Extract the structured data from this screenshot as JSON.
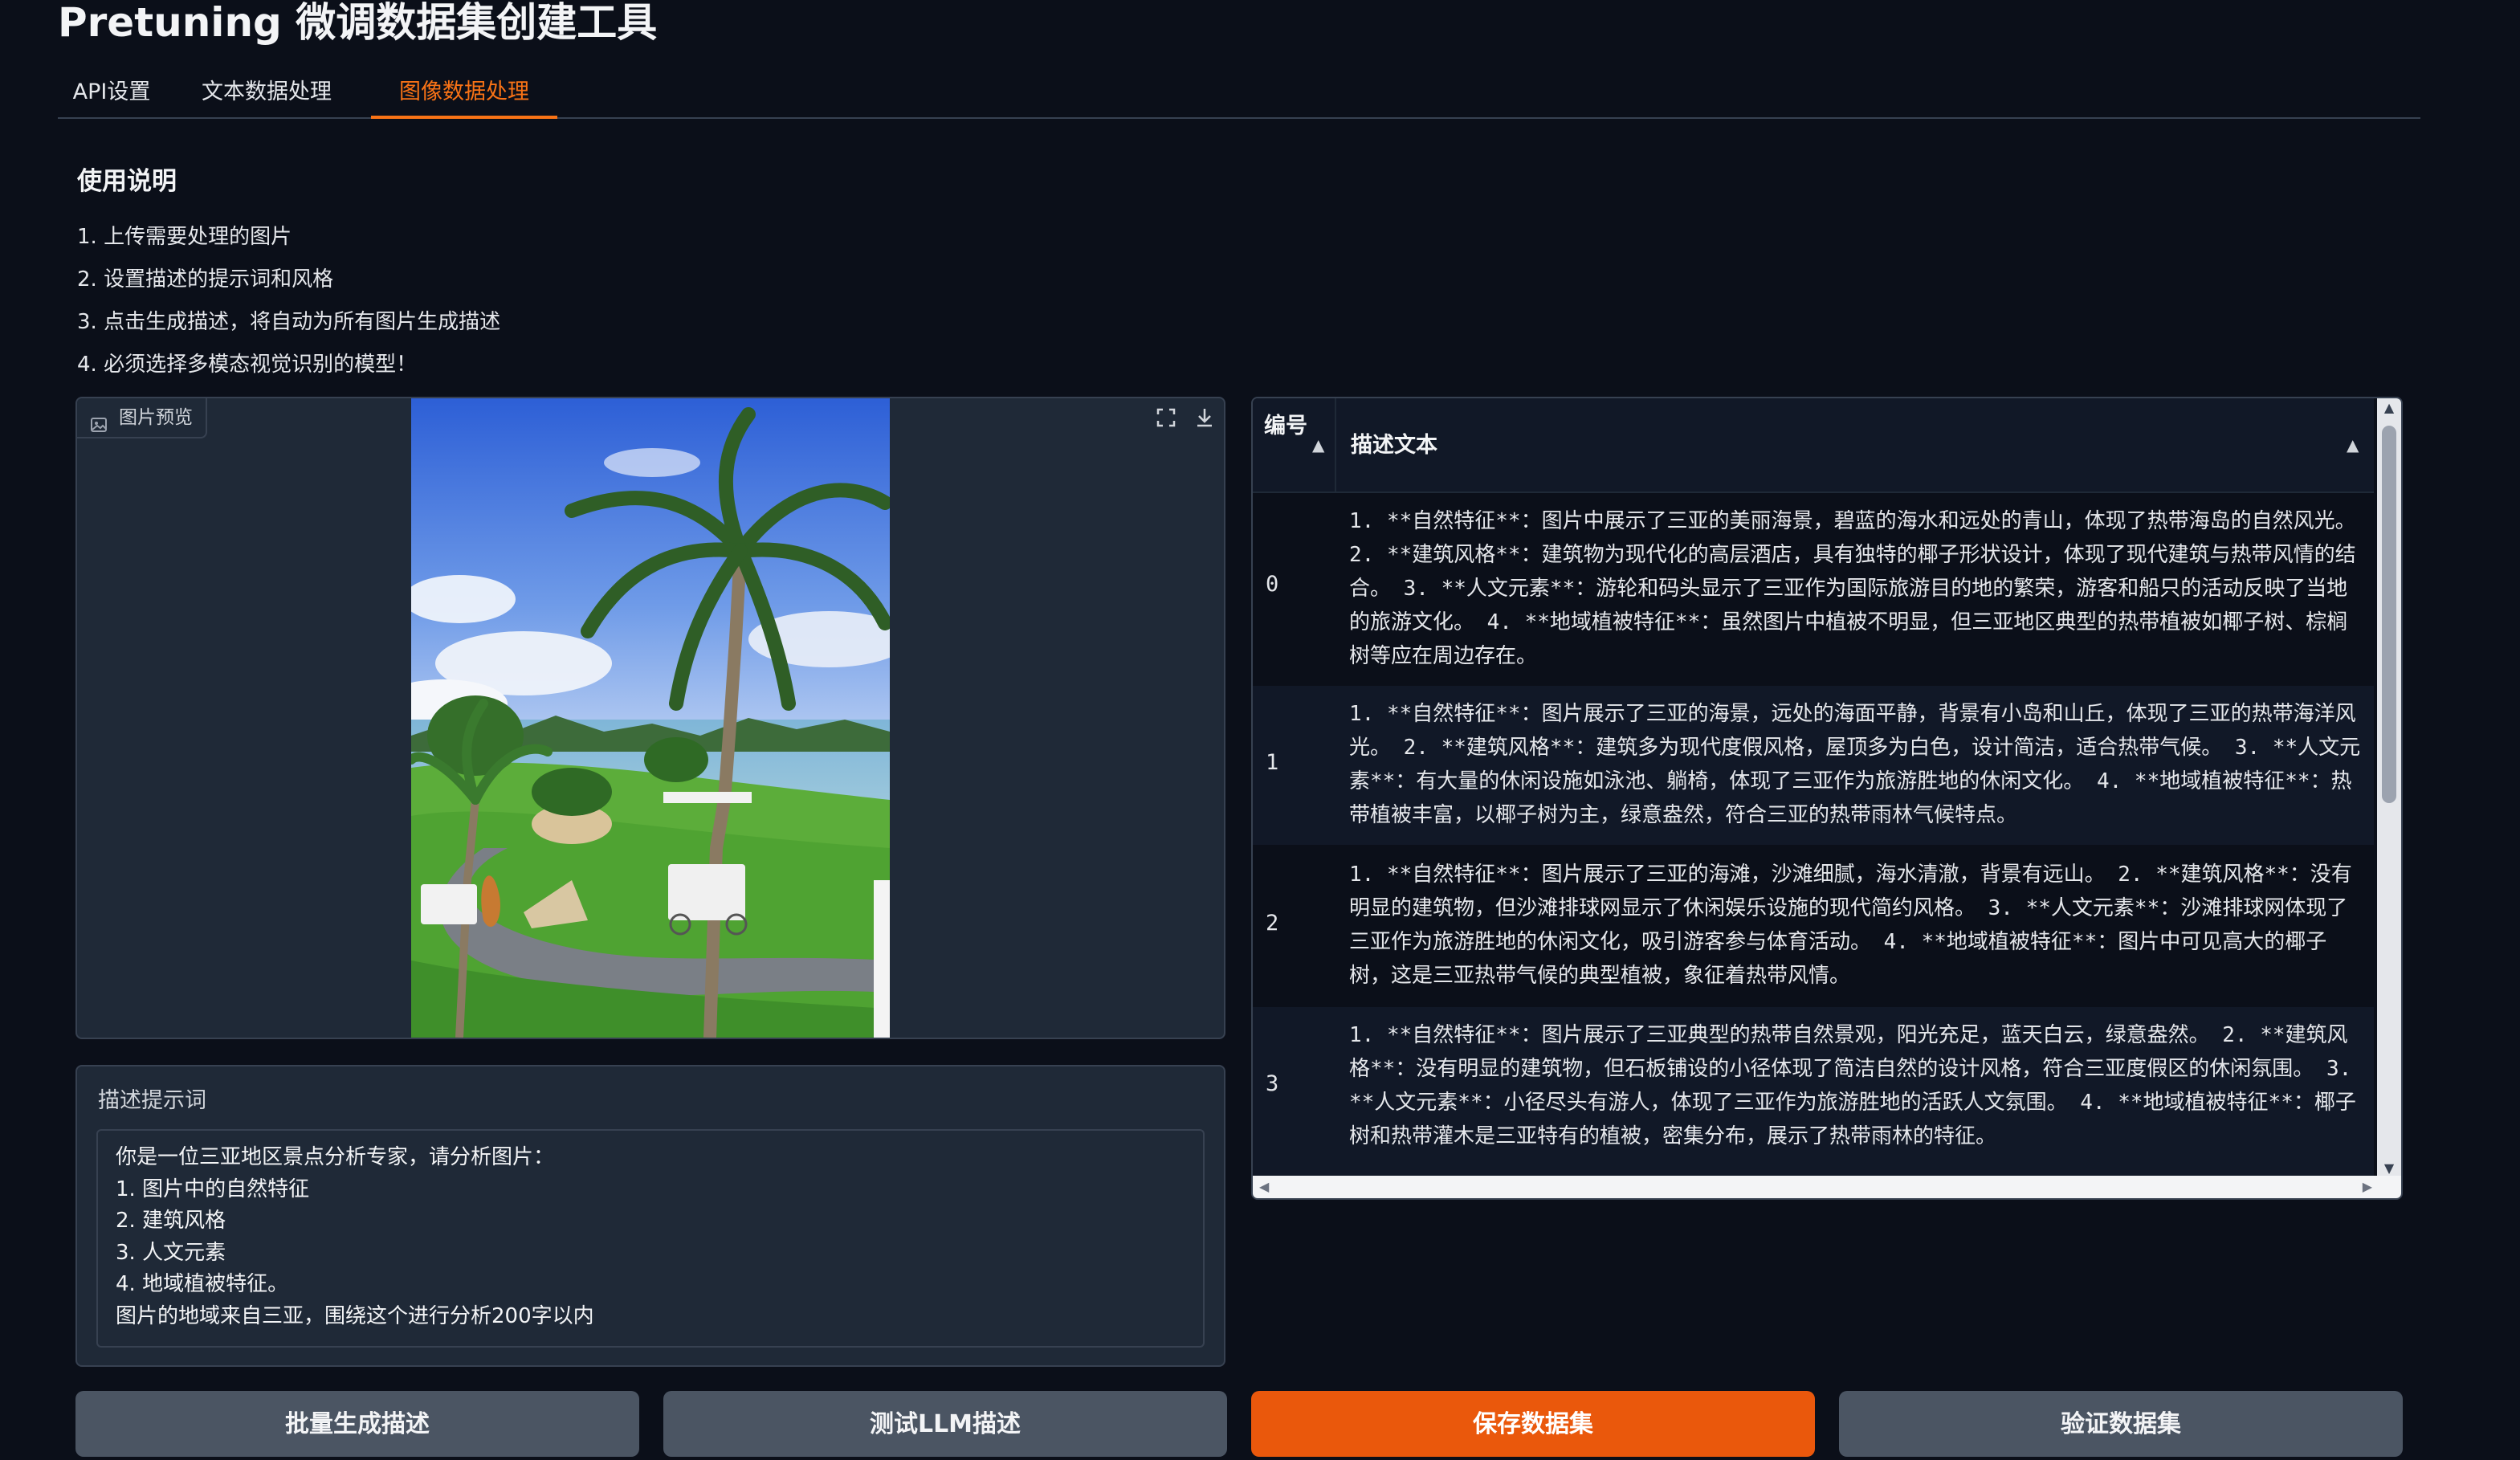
{
  "app": {
    "title": "Pretuning 微调数据集创建工具"
  },
  "tabs": [
    {
      "label": "API设置"
    },
    {
      "label": "文本数据处理"
    },
    {
      "label": "图像数据处理",
      "active": true
    }
  ],
  "instructions": {
    "heading": "使用说明",
    "lines": [
      "1. 上传需要处理的图片",
      "2. 设置描述的提示词和风格",
      "3. 点击生成描述，将自动为所有图片生成描述",
      "4. 必须选择多模态视觉识别的模型！"
    ]
  },
  "image_panel": {
    "label": "图片预览",
    "icons": [
      "image-icon",
      "fullscreen-icon",
      "download-icon"
    ]
  },
  "prompt": {
    "label": "描述提示词",
    "value": "你是一位三亚地区景点分析专家，请分析图片：\n1. 图片中的自然特征\n2. 建筑风格\n3. 人文元素\n4. 地域植被特征。\n图片的地域来自三亚，围绕这个进行分析200字以内"
  },
  "table": {
    "columns": [
      "编号",
      "描述文本"
    ],
    "rows": [
      {
        "id": "0",
        "text": "1. **自然特征**：图片中展示了三亚的美丽海景，碧蓝的海水和远处的青山，体现了热带海岛的自然风光。 2. **建筑风格**：建筑物为现代化的高层酒店，具有独特的椰子形状设计，体现了现代建筑与热带风情的结合。 3. **人文元素**：游轮和码头显示了三亚作为国际旅游目的地的繁荣，游客和船只的活动反映了当地的旅游文化。 4. **地域植被特征**：虽然图片中植被不明显，但三亚地区典型的热带植被如椰子树、棕榈树等应在周边存在。"
      },
      {
        "id": "1",
        "text": "1. **自然特征**：图片展示了三亚的海景，远处的海面平静，背景有小岛和山丘，体现了三亚的热带海洋风光。 2. **建筑风格**：建筑多为现代度假风格，屋顶多为白色，设计简洁，适合热带气候。 3. **人文元素**：有大量的休闲设施如泳池、躺椅，体现了三亚作为旅游胜地的休闲文化。 4. **地域植被特征**：热带植被丰富，以椰子树为主，绿意盎然，符合三亚的热带雨林气候特点。"
      },
      {
        "id": "2",
        "text": "1. **自然特征**：图片展示了三亚的海滩，沙滩细腻，海水清澈，背景有远山。 2. **建筑风格**：没有明显的建筑物，但沙滩排球网显示了休闲娱乐设施的现代简约风格。 3. **人文元素**：沙滩排球网体现了三亚作为旅游胜地的休闲文化，吸引游客参与体育活动。 4. **地域植被特征**：图片中可见高大的椰子树，这是三亚热带气候的典型植被，象征着热带风情。"
      },
      {
        "id": "3",
        "text": "1. **自然特征**：图片展示了三亚典型的热带自然景观，阳光充足，蓝天白云，绿意盎然。 2. **建筑风格**：没有明显的建筑物，但石板铺设的小径体现了简洁自然的设计风格，符合三亚度假区的休闲氛围。 3. **人文元素**：小径尽头有游人，体现了三亚作为旅游胜地的活跃人文氛围。 4. **地域植被特征**：椰子树和热带灌木是三亚特有的植被，密集分布，展示了热带雨林的特征。"
      }
    ]
  },
  "buttons": {
    "batch_generate": "批量生成描述",
    "test_llm": "测试LLM描述",
    "save_dataset": "保存数据集",
    "validate_dataset": "验证数据集"
  },
  "colors": {
    "accent": "#ea580c",
    "background": "#0b0f19",
    "panel": "#1f2937"
  }
}
